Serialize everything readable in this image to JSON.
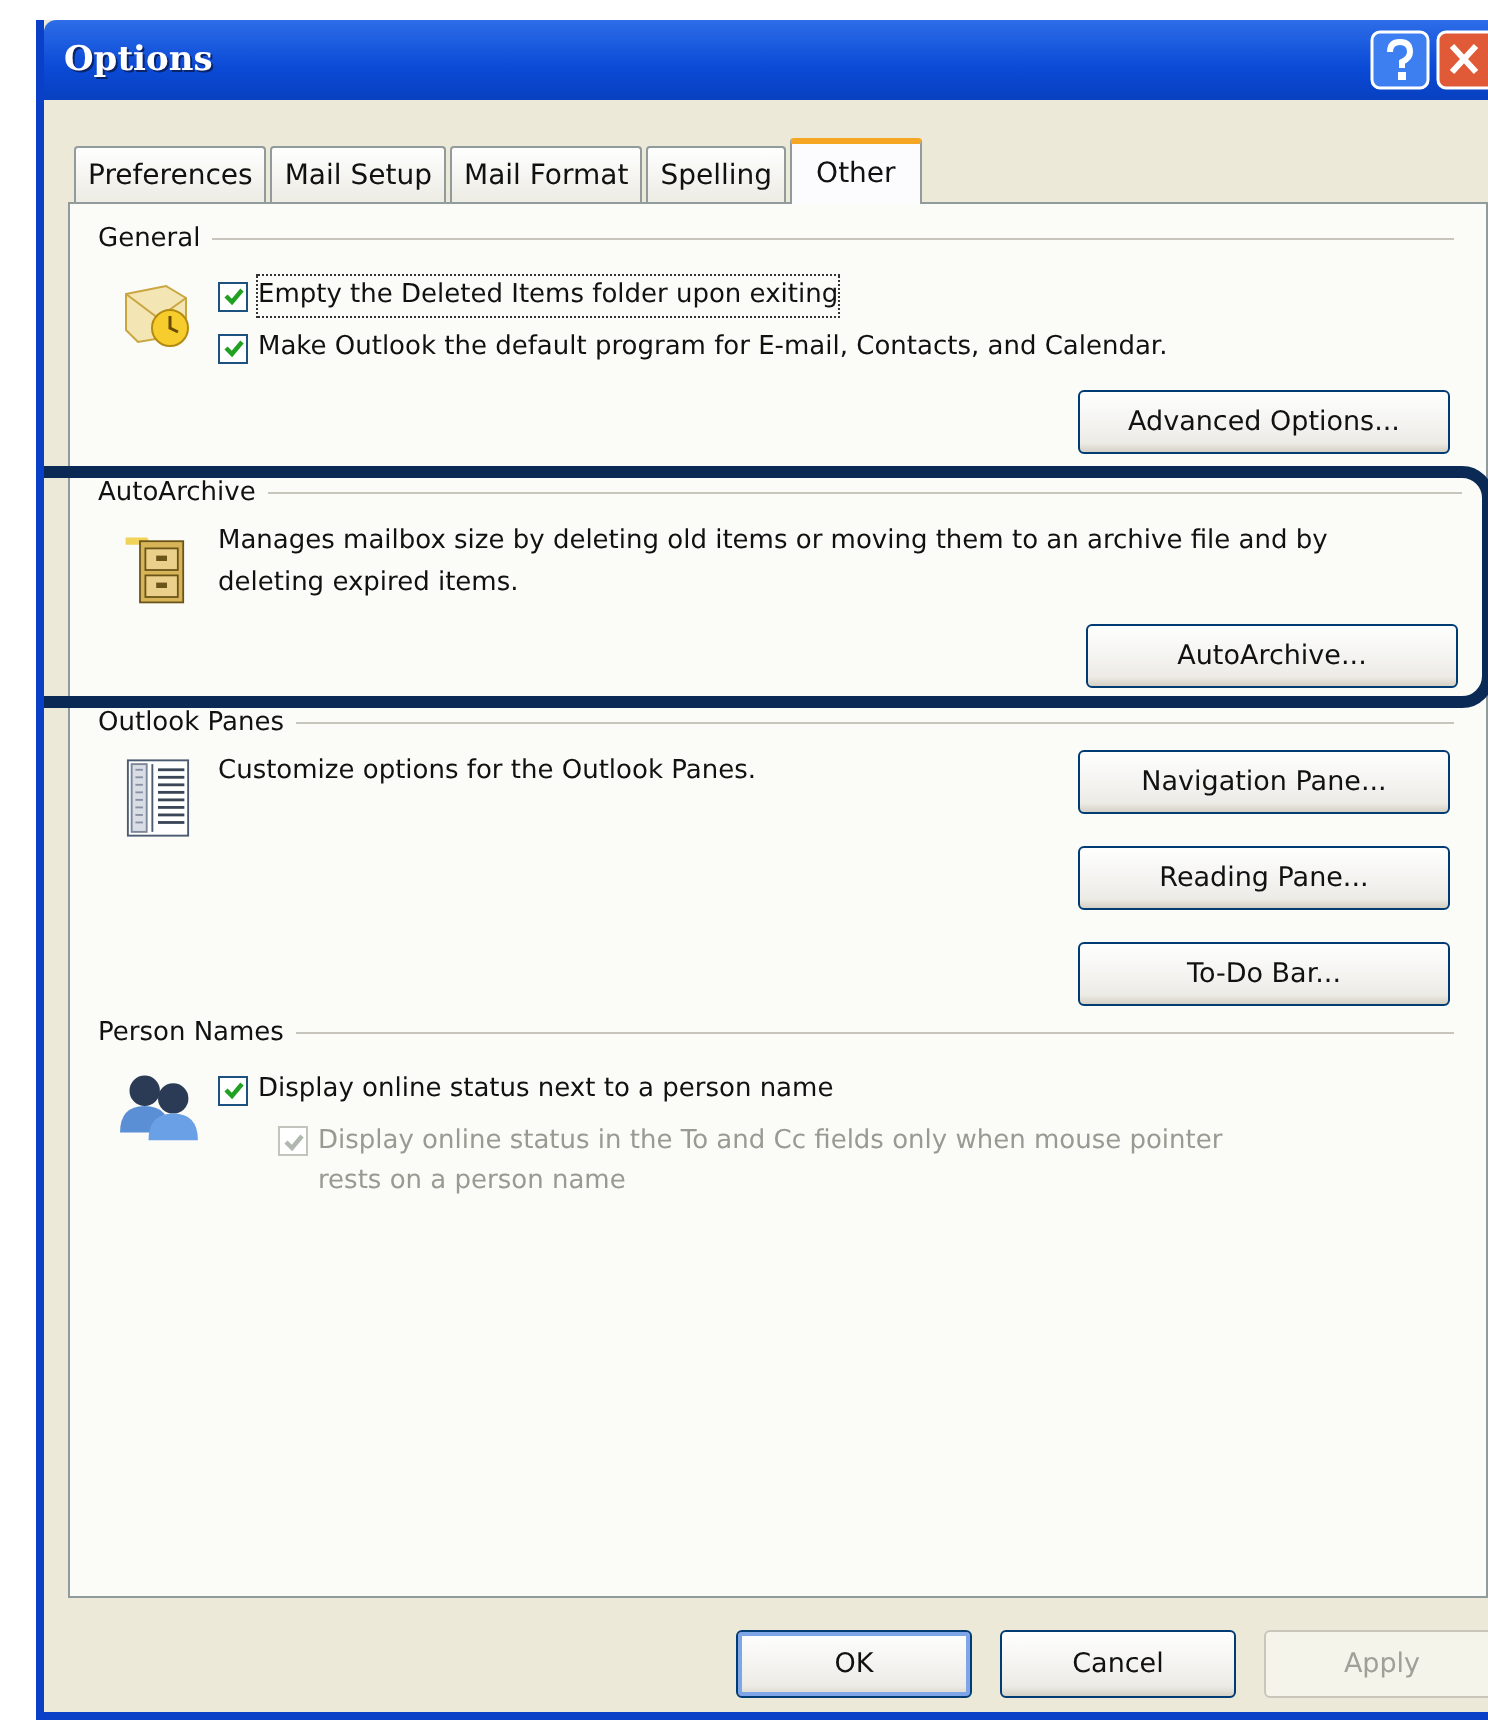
{
  "window": {
    "title": "Options"
  },
  "tabs": [
    {
      "label": "Preferences",
      "selected": false
    },
    {
      "label": "Mail Setup",
      "selected": false
    },
    {
      "label": "Mail Format",
      "selected": false
    },
    {
      "label": "Spelling",
      "selected": false
    },
    {
      "label": "Other",
      "selected": true
    }
  ],
  "sections": [
    {
      "heading": "General",
      "kind": "mail",
      "highlighted": false,
      "checkboxes": [
        {
          "label": "Empty the Deleted Items folder upon exiting",
          "checked": true,
          "disabled": false,
          "focused": true
        },
        {
          "label": "Make Outlook the default program for E-mail, Contacts, and Calendar.",
          "checked": true,
          "disabled": false,
          "focused": false
        }
      ],
      "buttons": [
        "Advanced Options..."
      ]
    },
    {
      "heading": "AutoArchive",
      "kind": "cabinet",
      "highlighted": true,
      "description": "Manages mailbox size by deleting old items or moving them to an archive file and by deleting expired items.",
      "buttons": [
        "AutoArchive..."
      ]
    },
    {
      "heading": "Outlook Panes",
      "kind": "panes",
      "highlighted": false,
      "description": "Customize options for the Outlook Panes.",
      "buttons": [
        "Navigation Pane...",
        "Reading Pane...",
        "To-Do Bar..."
      ]
    },
    {
      "heading": "Person Names",
      "kind": "people",
      "highlighted": false,
      "checkboxes": [
        {
          "label": "Display online status next to a person name",
          "checked": true,
          "disabled": false,
          "focused": false,
          "children": [
            {
              "label": "Display online status in the To and Cc fields only when mouse pointer rests on a person name",
              "checked": true,
              "disabled": true,
              "focused": false
            }
          ]
        }
      ]
    }
  ],
  "footer_buttons": [
    {
      "label": "OK",
      "disabled": false,
      "default": true
    },
    {
      "label": "Cancel",
      "disabled": false,
      "default": false
    },
    {
      "label": "Apply",
      "disabled": true,
      "default": false
    }
  ]
}
